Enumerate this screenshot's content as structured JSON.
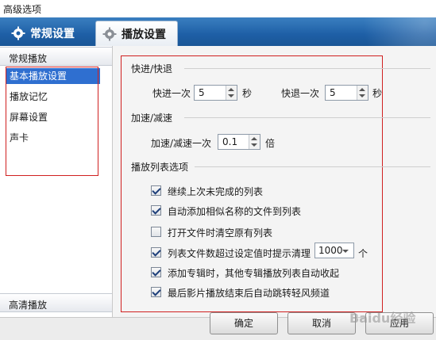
{
  "window": {
    "title": "高级选项"
  },
  "tabs": [
    {
      "label": "常规设置",
      "icon": "gear-icon",
      "active": false
    },
    {
      "label": "播放设置",
      "icon": "gear-icon",
      "active": true
    }
  ],
  "sidebar": {
    "group_top": "常规播放",
    "items": [
      {
        "label": "基本播放设置",
        "selected": true
      },
      {
        "label": "播放记忆",
        "selected": false
      },
      {
        "label": "屏幕设置",
        "selected": false
      },
      {
        "label": "声卡",
        "selected": false
      }
    ],
    "group_bottom": "高清播放"
  },
  "seek": {
    "title": "快进/快退",
    "forward_label": "快进一次",
    "forward_value": "5",
    "forward_unit": "秒",
    "backward_label": "快退一次",
    "backward_value": "5",
    "backward_unit": "秒"
  },
  "speed": {
    "title": "加速/减速",
    "label": "加速/减速一次",
    "value": "0.1",
    "unit": "倍"
  },
  "playlist": {
    "title": "播放列表选项",
    "options": [
      {
        "label": "继续上次未完成的列表",
        "checked": true
      },
      {
        "label": "自动添加相似名称的文件到列表",
        "checked": true
      },
      {
        "label": "打开文件时清空原有列表",
        "checked": false
      },
      {
        "label": "列表文件数超过设定值时提示清理",
        "checked": true
      },
      {
        "label": "添加专辑时，其他专辑播放列表自动收起",
        "checked": true
      },
      {
        "label": "最后影片播放结束后自动跳转轻风频道",
        "checked": true
      }
    ],
    "limit_value": "1000",
    "limit_unit": "个"
  },
  "buttons": {
    "ok": "确定",
    "cancel": "取消",
    "apply": "应用"
  },
  "watermark": "Baidu经验",
  "colors": {
    "tab_bar": "#1e5fa6",
    "selection": "#2f6fd0",
    "highlight_box": "#d02020"
  }
}
